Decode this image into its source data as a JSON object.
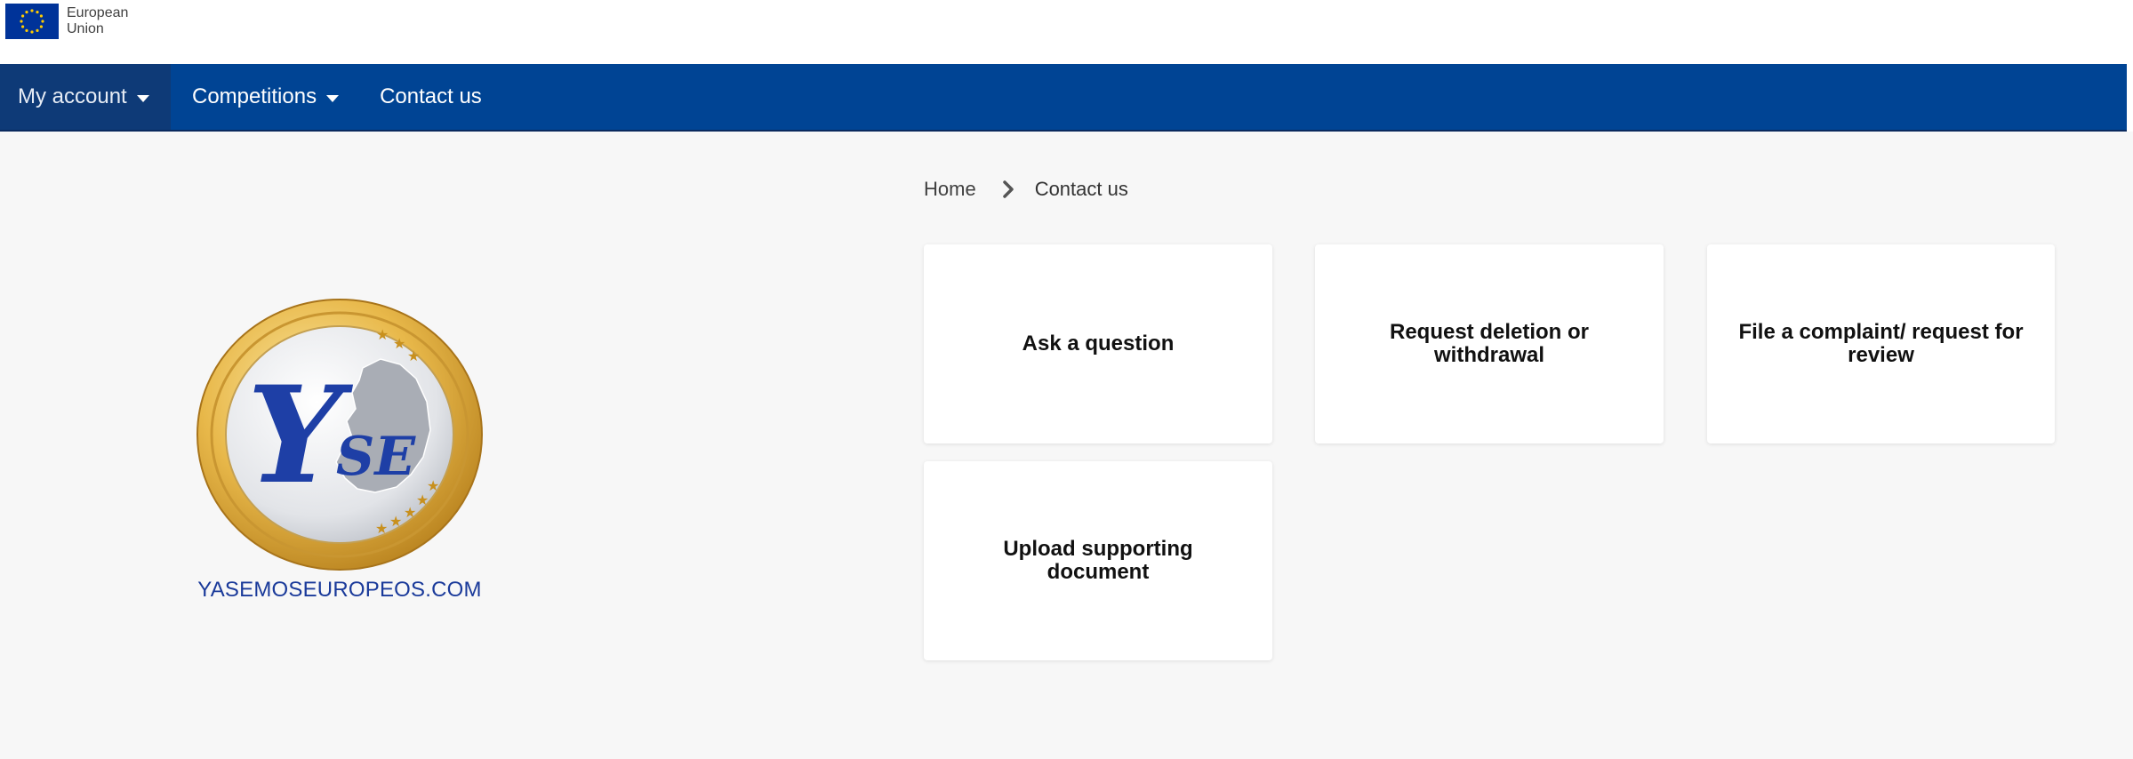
{
  "header": {
    "eu_logo_line1": "European",
    "eu_logo_line2": "Union"
  },
  "nav": {
    "items": [
      {
        "label": "My account",
        "has_dropdown": true,
        "active": true
      },
      {
        "label": "Competitions",
        "has_dropdown": true,
        "active": false
      },
      {
        "label": "Contact us",
        "has_dropdown": false,
        "active": false
      }
    ]
  },
  "breadcrumb": {
    "home": "Home",
    "current": "Contact us",
    "separator_icon": "chevron-right-icon"
  },
  "cards": [
    {
      "label": "Ask a question"
    },
    {
      "label": "Request deletion or withdrawal"
    },
    {
      "label": "File a complaint/ request for review"
    },
    {
      "label": "Upload supporting document"
    }
  ],
  "watermark": {
    "text": "YASEMOSEUROPEOS.COM"
  },
  "colors": {
    "navbar": "#004494",
    "active_nav": "#0e3a77",
    "background": "#f7f7f7",
    "card": "#ffffff",
    "watermark_text": "#1a3a9a"
  }
}
